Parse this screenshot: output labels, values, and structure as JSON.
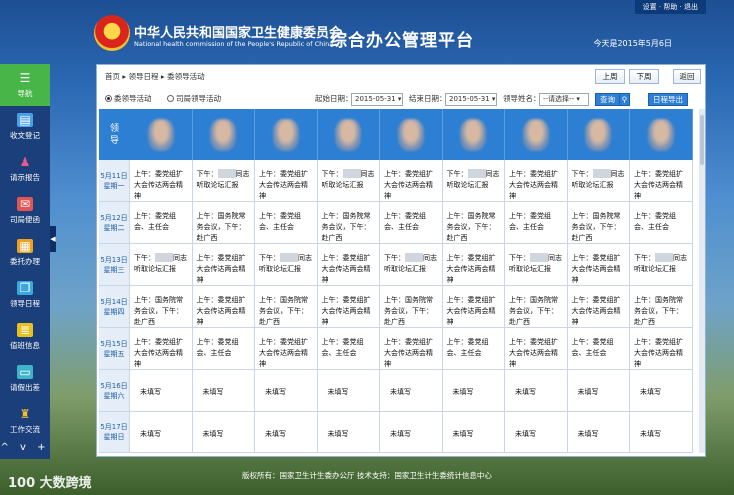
{
  "header": {
    "org_cn": "中华人民共和国国家卫生健康委员会",
    "org_en": "National health commission of the People's Republic of China",
    "platform_title": "综合办公管理平台",
    "top_links": "设置 · 帮助 · 退出",
    "today": "今天是2015年5月6日"
  },
  "sidebar": {
    "items": [
      {
        "label": "导航",
        "icon": "menu-icon"
      },
      {
        "label": "收文登记",
        "icon": "document-icon"
      },
      {
        "label": "请示报告",
        "icon": "person-icon"
      },
      {
        "label": "司局便函",
        "icon": "envelope-icon"
      },
      {
        "label": "委托办理",
        "icon": "calendar-icon"
      },
      {
        "label": "领导日程",
        "icon": "schedule-icon"
      },
      {
        "label": "值班信息",
        "icon": "notes-icon"
      },
      {
        "label": "请假出差",
        "icon": "car-icon"
      },
      {
        "label": "工作交流",
        "icon": "chat-icon"
      }
    ],
    "bottom_controls": "^ v +"
  },
  "panel": {
    "breadcrumb": "首页 ▸ 领导日程 ▸ 委领导活动",
    "prev_week": "上周",
    "next_week": "下周",
    "back": "返回",
    "radio_1": "委领导活动",
    "radio_2": "司局领导活动",
    "start_label": "起始日期：",
    "start_value": "2015-05-31",
    "end_label": "结束日期：",
    "end_value": "2015-05-31",
    "leader_label": "领导姓名：",
    "leader_value": "--请选择--",
    "query": "查询",
    "export": "日程导出",
    "header_label_1": "领",
    "header_label_2": "导"
  },
  "schedule": {
    "days": [
      {
        "date": "5月11日",
        "weekday": "星期一"
      },
      {
        "date": "5月12日",
        "weekday": "星期二"
      },
      {
        "date": "5月13日",
        "weekday": "星期三"
      },
      {
        "date": "5月14日",
        "weekday": "星期四"
      },
      {
        "date": "5月15日",
        "weekday": "星期五"
      },
      {
        "date": "5月16日",
        "weekday": "星期六"
      },
      {
        "date": "5月17日",
        "weekday": "星期日"
      }
    ],
    "texts": {
      "a": "上午：委党组扩大会传达两会精神",
      "b1": "下午：",
      "b2": "同志听取论坛汇报",
      "c": "上午：委党组会、主任会",
      "d": "上午：国务院常务会议，下午：赴广西",
      "u": "未填写"
    }
  },
  "footer": "版权所有：国家卫生计生委办公厅   技术支持：国家卫生计生委统计信息中心",
  "watermark": "100 大数跨境"
}
